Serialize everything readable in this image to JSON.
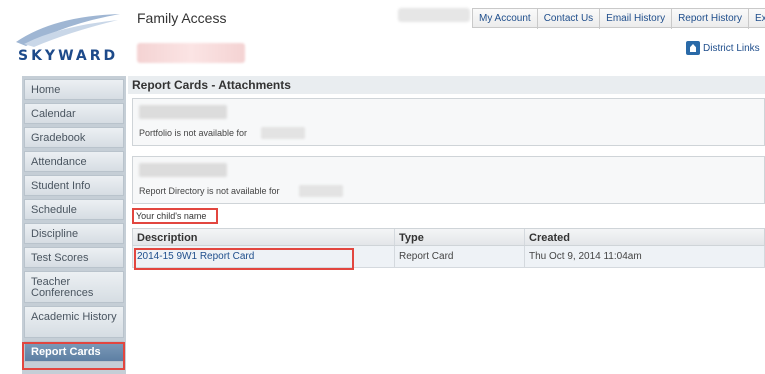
{
  "app": {
    "title": "Family Access",
    "logo_text": "SKYWARD"
  },
  "top_links": [
    "My Account",
    "Contact Us",
    "Email History",
    "Report History",
    "Exit"
  ],
  "district_links": "District Links",
  "sidebar": {
    "items": [
      {
        "label": "Home"
      },
      {
        "label": "Calendar"
      },
      {
        "label": "Gradebook"
      },
      {
        "label": "Attendance"
      },
      {
        "label": "Student Info"
      },
      {
        "label": "Schedule"
      },
      {
        "label": "Discipline"
      },
      {
        "label": "Test Scores"
      },
      {
        "label": "Teacher Conferences"
      },
      {
        "label": "Academic History"
      },
      {
        "label": "Report Cards"
      }
    ],
    "active": "Report Cards"
  },
  "main": {
    "title": "Report Cards - Attachments",
    "portfolio_msg": "Portfolio is not available for",
    "directory_msg": "Report Directory is not available for",
    "child_label": "Your child's name",
    "table": {
      "headers": [
        "Description",
        "Type",
        "Created"
      ],
      "rows": [
        {
          "description": "2014-15 9W1 Report Card",
          "type": "Report Card",
          "created": "Thu Oct 9, 2014 11:04am"
        }
      ]
    }
  },
  "colors": {
    "brand_blue": "#1d4a8a",
    "highlight_red": "#e2463f",
    "active_nav": "#6a8bac"
  }
}
